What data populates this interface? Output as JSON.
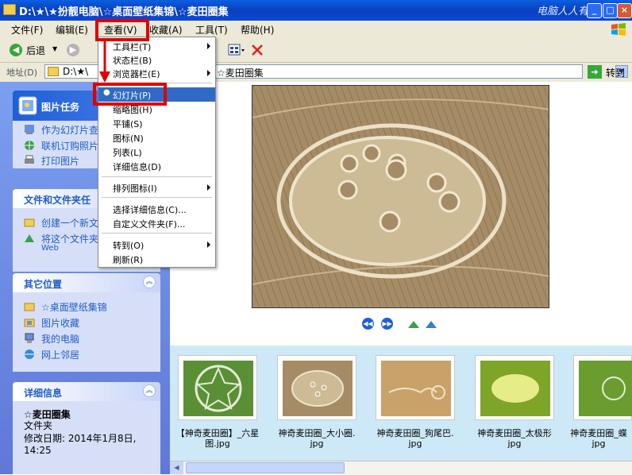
{
  "window": {
    "title": "D:\\★\\★扮靓电脑\\☆桌面壁纸集锦\\☆麦田圈集",
    "brand": "电脑人人有",
    "controls": {
      "minimize": "_",
      "maximize": "□",
      "close": "×"
    }
  },
  "menubar": {
    "items": [
      "文件(F)",
      "编辑(E)",
      "查看(V)",
      "收藏(A)",
      "工具(T)",
      "帮助(H)"
    ]
  },
  "toolbar": {
    "back_label": "后退"
  },
  "address": {
    "label": "地址(D)",
    "path_start": "D:\\★\\",
    "path_end": "☆麦田圈集",
    "go_label": "转到"
  },
  "dropdown": {
    "items": [
      {
        "label": "工具栏(T)",
        "submenu": true
      },
      {
        "label": "状态栏(B)",
        "submenu": false
      },
      {
        "label": "浏览器栏(E)",
        "submenu": true
      },
      {
        "label": "幻灯片(P)",
        "selected": true
      },
      {
        "label": "缩略图(H)"
      },
      {
        "label": "平铺(S)"
      },
      {
        "label": "图标(N)"
      },
      {
        "label": "列表(L)"
      },
      {
        "label": "详细信息(D)"
      },
      {
        "label": "排列图标(I)",
        "submenu": true
      },
      {
        "label": "选择详细信息(C)..."
      },
      {
        "label": "自定义文件夹(F)..."
      },
      {
        "label": "转到(O)",
        "submenu": true
      },
      {
        "label": "刷新(R)"
      }
    ]
  },
  "sidebar": {
    "picture_tasks": {
      "title": "图片任务",
      "items": [
        "作为幻灯片查",
        "联机订购照片",
        "打印图片"
      ]
    },
    "file_tasks": {
      "title": "文件和文件夹任",
      "items": [
        "创建一个新文",
        "将这个文件夹",
        "Web"
      ]
    },
    "other_places": {
      "title": "其它位置",
      "items": [
        "☆桌面壁纸集锦",
        "图片收藏",
        "我的电脑",
        "网上邻居"
      ]
    },
    "details": {
      "title": "详细信息",
      "name": "☆麦田圈集",
      "type": "文件夹",
      "modified": "修改日期: 2014年1月8日, 14:25"
    }
  },
  "thumbnails": [
    {
      "caption1": "【神奇麦田圈】_六星",
      "caption2": "图.jpg"
    },
    {
      "caption1": "神奇麦田圈_大小圈.",
      "caption2": "jpg"
    },
    {
      "caption1": "神奇麦田圈_狗尾巴.",
      "caption2": "jpg"
    },
    {
      "caption1": "神奇麦田圈_太极形",
      "caption2": "jpg"
    },
    {
      "caption1": "神奇麦田圈_蝶",
      "caption2": "jpg"
    }
  ],
  "colors": {
    "highlight": "#e00000",
    "selection": "#316ac5",
    "xp_blue": "#0a3fc0"
  }
}
